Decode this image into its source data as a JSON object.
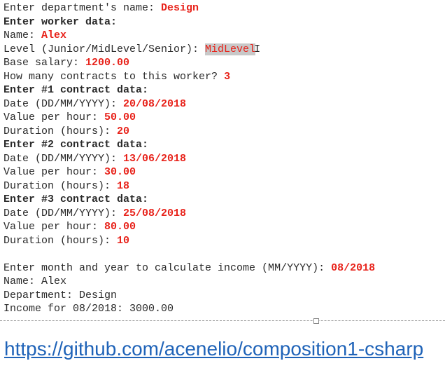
{
  "console": {
    "lines": [
      [
        {
          "t": "Enter department's name: ",
          "s": ""
        },
        {
          "t": "Design",
          "s": "in"
        }
      ],
      [
        {
          "t": "Enter worker data:",
          "s": "b"
        }
      ],
      [
        {
          "t": "Name: ",
          "s": ""
        },
        {
          "t": "Alex",
          "s": "in"
        }
      ],
      [
        {
          "t": "Level (Junior/MidLevel/Senior): ",
          "s": ""
        },
        {
          "t": "MidLevel",
          "s": "sel"
        }
      ],
      [
        {
          "t": "Base salary: ",
          "s": ""
        },
        {
          "t": "1200.00",
          "s": "in"
        }
      ],
      [
        {
          "t": "How many contracts to this worker? ",
          "s": ""
        },
        {
          "t": "3",
          "s": "in"
        }
      ],
      [
        {
          "t": "Enter #1 contract data:",
          "s": "b"
        }
      ],
      [
        {
          "t": "Date (DD/MM/YYYY): ",
          "s": ""
        },
        {
          "t": "20/08/2018",
          "s": "in"
        }
      ],
      [
        {
          "t": "Value per hour: ",
          "s": ""
        },
        {
          "t": "50.00",
          "s": "in"
        }
      ],
      [
        {
          "t": "Duration (hours): ",
          "s": ""
        },
        {
          "t": "20",
          "s": "in"
        }
      ],
      [
        {
          "t": "Enter #2 contract data:",
          "s": "b"
        }
      ],
      [
        {
          "t": "Date (DD/MM/YYYY): ",
          "s": ""
        },
        {
          "t": "13/06/2018",
          "s": "in"
        }
      ],
      [
        {
          "t": "Value per hour: ",
          "s": ""
        },
        {
          "t": "30.00",
          "s": "in"
        }
      ],
      [
        {
          "t": "Duration (hours): ",
          "s": ""
        },
        {
          "t": "18",
          "s": "in"
        }
      ],
      [
        {
          "t": "Enter #3 contract data:",
          "s": "b"
        }
      ],
      [
        {
          "t": "Date (DD/MM/YYYY): ",
          "s": ""
        },
        {
          "t": "25/08/2018",
          "s": "in"
        }
      ],
      [
        {
          "t": "Value per hour: ",
          "s": ""
        },
        {
          "t": "80.00",
          "s": "in"
        }
      ],
      [
        {
          "t": "Duration (hours): ",
          "s": ""
        },
        {
          "t": "10",
          "s": "in"
        }
      ],
      [],
      [
        {
          "t": "Enter month and year to calculate income (MM/YYYY): ",
          "s": ""
        },
        {
          "t": "08/2018",
          "s": "in"
        }
      ],
      [
        {
          "t": "Name: Alex",
          "s": ""
        }
      ],
      [
        {
          "t": "Department: Design",
          "s": ""
        }
      ],
      [
        {
          "t": "Income for 08/2018: 3000.00",
          "s": ""
        }
      ]
    ]
  },
  "link": {
    "text": "https://github.com/acenelio/composition1-csharp"
  },
  "colors": {
    "input": "#e8231b",
    "link": "#1f63b8"
  }
}
